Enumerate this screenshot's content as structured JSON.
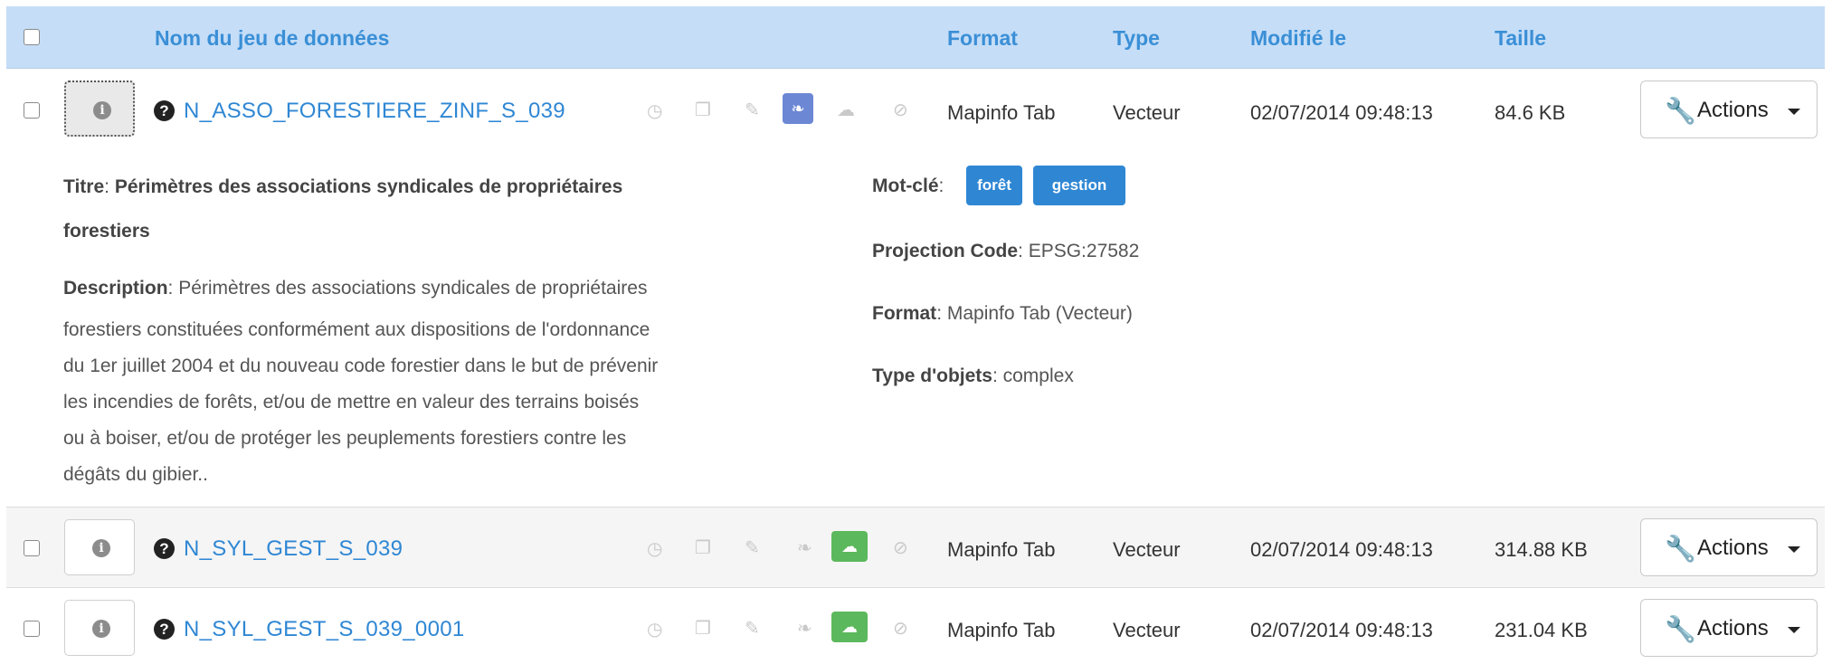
{
  "header": {
    "col_name": "Nom du jeu de données",
    "col_format": "Format",
    "col_type": "Type",
    "col_modified": "Modifié le",
    "col_size": "Taille"
  },
  "rows": [
    {
      "name": "N_ASSO_FORESTIERE_ZINF_S_039",
      "format": "Mapinfo Tab",
      "type": "Vecteur",
      "modified": "02/07/2014 09:48:13",
      "size": "84.6 KB",
      "actions_label": "Actions"
    },
    {
      "name": "N_SYL_GEST_S_039",
      "format": "Mapinfo Tab",
      "type": "Vecteur",
      "modified": "02/07/2014 09:48:13",
      "size": "314.88 KB",
      "actions_label": "Actions"
    },
    {
      "name": "N_SYL_GEST_S_039_0001",
      "format": "Mapinfo Tab",
      "type": "Vecteur",
      "modified": "02/07/2014 09:48:13",
      "size": "231.04 KB",
      "actions_label": "Actions"
    }
  ],
  "detail": {
    "title_label": "Titre",
    "title_line1": "Périmètres des associations syndicales de propriétaires",
    "title_line2": "forestiers",
    "desc_label": "Description",
    "desc_line1": "Périmètres des associations syndicales de propriétaires",
    "desc_line2": "forestiers constituées conformément aux dispositions de l'ordonnance",
    "desc_line3": "du 1er juillet 2004 et du nouveau code forestier dans le but de prévenir",
    "desc_line4": "les incendies de forêts, et/ou de mettre en valeur des terrains boisés",
    "desc_line5": "ou à boiser, et/ou de protéger les peuplements forestiers contre les",
    "desc_line6": "dégâts du gibier..",
    "keyword_label": "Mot-clé",
    "keywords": [
      "forêt",
      "gestion"
    ],
    "projection_label": "Projection Code",
    "projection_value": "EPSG:27582",
    "format_label": "Format",
    "format_value": "Mapinfo Tab (Vecteur)",
    "objtype_label": "Type d'objets",
    "objtype_value": "complex"
  },
  "icons": {
    "info": "info-icon",
    "help": "question-circle-icon",
    "history": "clock-icon",
    "copy": "copy-icon",
    "pin": "pin-icon",
    "feather": "feather-icon",
    "cloud": "cloud-upload-icon",
    "clip": "paperclip-icon",
    "wrench": "wrench-icon"
  },
  "colors": {
    "header_bg": "#c5ddf7",
    "link": "#2f87d4",
    "feather_active": "#6c87d4",
    "cloud_active": "#5cb85c"
  }
}
